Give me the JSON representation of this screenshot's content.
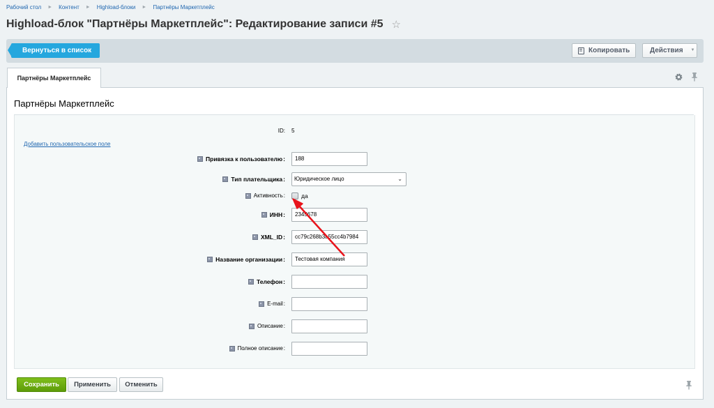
{
  "breadcrumbs": [
    "Рабочий стол",
    "Контент",
    "Highload-блоки",
    "Партнёры Маркетплейс"
  ],
  "page_title": "Highload-блок \"Партнёры Маркетплейс\": Редактирование записи #5",
  "toolbar": {
    "back_label": "Вернуться в список",
    "copy_label": "Копировать",
    "actions_label": "Действия"
  },
  "tabs": [
    {
      "label": "Партнёры Маркетплейс"
    }
  ],
  "section_title": "Партнёры Маркетплейс",
  "add_field_link": "Добавить пользовательское поле",
  "form": {
    "id_label": "ID:",
    "id_value": "5",
    "user_label": "Привязка к пользователю",
    "user_value": "188",
    "payer_label": "Тип плательщика",
    "payer_value": "Юридическое лицо",
    "active_label": "Активность",
    "active_checkbox_label": "да",
    "inn_label": "ИНН",
    "inn_value": "2345678",
    "xmlid_label": "XML_ID",
    "xmlid_value": "cc79c268b3a55cc4b7984",
    "org_label": "Название организации",
    "org_value": "Тестовая компания",
    "phone_label": "Телефон",
    "phone_value": "",
    "email_label": "E-mail",
    "email_value": "",
    "desc_label": "Описание",
    "desc_value": "",
    "fulldesc_label": "Полное описание",
    "fulldesc_value": ""
  },
  "buttons": {
    "save": "Сохранить",
    "apply": "Применить",
    "cancel": "Отменить"
  },
  "colors": {
    "accent": "#25a7de",
    "save_green": "#6aad12",
    "annotation_arrow": "#e8141c"
  },
  "icons": [
    "star-icon",
    "copy-icon",
    "chevron-down-icon",
    "gear-icon",
    "pin-icon",
    "help-icon"
  ]
}
